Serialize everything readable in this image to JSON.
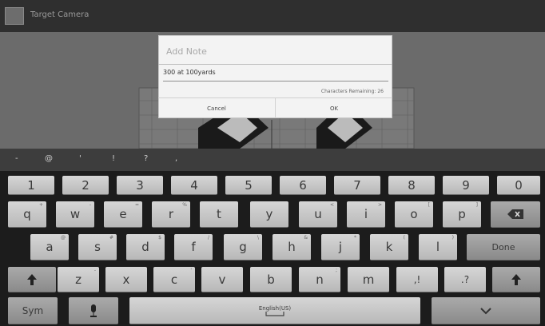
{
  "app": {
    "title": "Target Camera"
  },
  "dialog": {
    "title": "Add Note",
    "input_value": "300 at 100yards",
    "char_counter": "Characters Remaining: 26",
    "cancel_label": "Cancel",
    "ok_label": "OK"
  },
  "suggestions": [
    "-",
    "@",
    "'",
    "!",
    "?",
    ","
  ],
  "keyboard": {
    "row1": [
      "1",
      "2",
      "3",
      "4",
      "5",
      "6",
      "7",
      "8",
      "9",
      "0"
    ],
    "row2": [
      "q",
      "w",
      "e",
      "r",
      "t",
      "y",
      "u",
      "i",
      "o",
      "p"
    ],
    "row2_hints": [
      "+",
      "-",
      "=",
      "%",
      "",
      "",
      "<",
      ">",
      "[",
      "]"
    ],
    "row3": [
      "a",
      "s",
      "d",
      "f",
      "g",
      "h",
      "j",
      "k",
      "l"
    ],
    "row3_hints": [
      "@",
      "#",
      "$",
      "/",
      "\\",
      "&",
      "*",
      "(",
      ")"
    ],
    "done_label": "Done",
    "row4": [
      "z",
      "x",
      "c",
      "v",
      "b",
      "n",
      "m",
      ",!",
      ".?"
    ],
    "row4_hints": [
      "-",
      "",
      "'",
      "",
      "",
      ";",
      "",
      "",
      ""
    ],
    "sym_label": "Sym",
    "space_label": "English(US)"
  }
}
